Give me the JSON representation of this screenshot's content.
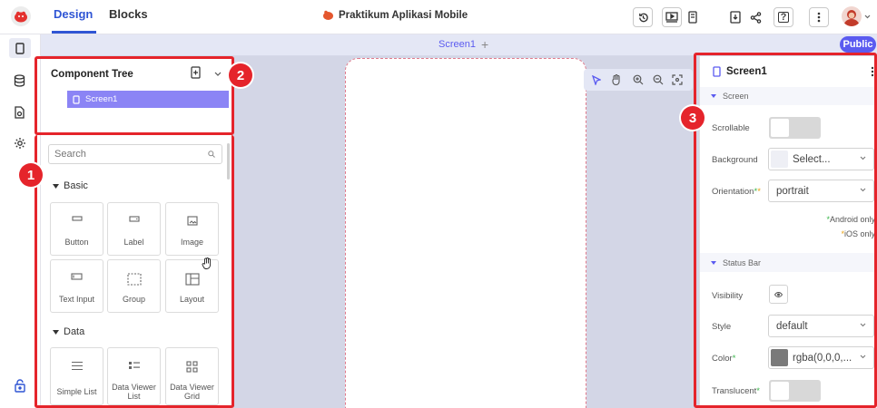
{
  "topbar": {
    "tab_design": "Design",
    "tab_blocks": "Blocks",
    "project_title": "Praktikum Aplikasi Mobile",
    "buttons": {
      "history": "history-icon",
      "preview": "play-icon",
      "device": "device-icon",
      "export": "export-icon",
      "share": "share-icon",
      "help": "?",
      "more": "more-icon"
    },
    "accent_color": "#2f55d4"
  },
  "screenbar": {
    "screen_tab": "Screen1",
    "add": "+",
    "public_badge": "Public",
    "public_color": "#5b5bf0"
  },
  "component_tree": {
    "title": "Component Tree",
    "items": [
      {
        "label": "Screen1",
        "selected": true
      }
    ],
    "selected_color": "#8b84f5"
  },
  "palette": {
    "search_placeholder": "Search",
    "sections": [
      {
        "title": "Basic",
        "items": [
          {
            "label": "Button",
            "icon": "button-icon"
          },
          {
            "label": "Label",
            "icon": "label-icon"
          },
          {
            "label": "Image",
            "icon": "image-icon"
          },
          {
            "label": "Text Input",
            "icon": "text-input-icon"
          },
          {
            "label": "Group",
            "icon": "group-icon"
          },
          {
            "label": "Layout",
            "icon": "layout-icon"
          }
        ]
      },
      {
        "title": "Data",
        "items": [
          {
            "label": "Simple List",
            "icon": "list-icon"
          },
          {
            "label": "Data Viewer List",
            "icon": "data-viewer-list-icon"
          },
          {
            "label": "Data Viewer Grid",
            "icon": "grid-icon"
          }
        ]
      }
    ]
  },
  "properties": {
    "title": "Screen1",
    "screen_section": "Screen",
    "scrollable_label": "Scrollable",
    "scrollable_value": false,
    "background_label": "Background",
    "background_value": "Select...",
    "orientation_label": "Orientation",
    "orientation_value": "portrait",
    "android_note": "Android only",
    "ios_note": "iOS only",
    "status_section": "Status Bar",
    "visibility_label": "Visibility",
    "style_label": "Style",
    "style_value": "default",
    "color_label": "Color",
    "color_value": "rgba(0,0,0,...",
    "translucent_label": "Translucent",
    "translucent_value": false,
    "android_mark_color": "#3ab54a",
    "ios_mark_color": "#e8a317"
  },
  "annotations": [
    "1",
    "2",
    "3"
  ],
  "annotation_color": "#e5242b"
}
